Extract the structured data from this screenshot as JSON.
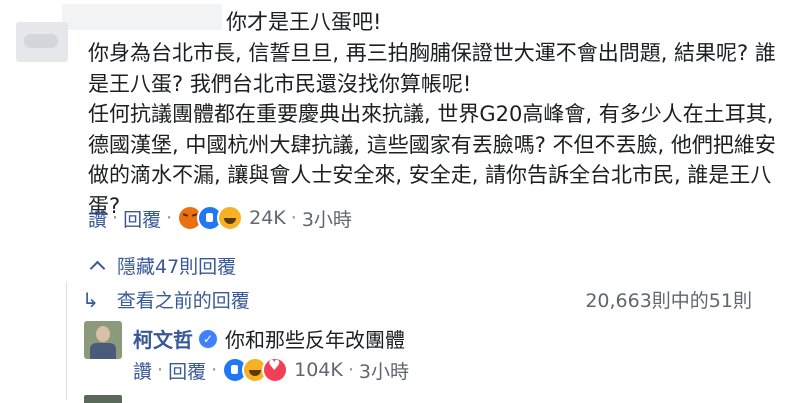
{
  "comment": {
    "headline": "你才是王八蛋吧!",
    "paragraphs": [
      "你身為台北市長, 信誓旦旦, 再三拍胸脯保證世大運不會出問題, 結果呢? 誰是王八蛋? 我們台北市民還沒找你算帳呢!",
      "任何抗議團體都在重要慶典出來抗議, 世界G20高峰會, 有多少人在土耳其, 德國漢堡, 中國杭州大肆抗議, 這些國家有丟臉嗎? 不但不丟臉, 他們把維安做的滴水不漏, 讓與會人士安全來, 安全走, 請你告訴全台北市民, 誰是王八蛋?"
    ],
    "actions": {
      "like_label": "讚",
      "reply_label": "回覆",
      "reaction_icons": [
        "angry-icon",
        "like-icon",
        "haha-icon"
      ],
      "reaction_count": "24K",
      "time": "3小時"
    }
  },
  "replies": {
    "hide_label": "隱藏47則回覆",
    "view_previous_label": "查看之前的回覆",
    "count_text": "20,663則中的51則",
    "items": [
      {
        "author": "柯文哲",
        "verified": true,
        "text": "你和那些反年改團體",
        "actions": {
          "like_label": "讚",
          "reply_label": "回覆",
          "reaction_icons": [
            "like-icon",
            "haha-icon",
            "love-icon"
          ],
          "reaction_count": "104K",
          "time": "3小時"
        }
      }
    ]
  },
  "colors": {
    "link": "#385898",
    "meta": "#616770",
    "verified": "#4080ff",
    "angry": "#e9710f",
    "like": "#2078f4",
    "haha": "#f7b125",
    "love": "#f33e58"
  }
}
